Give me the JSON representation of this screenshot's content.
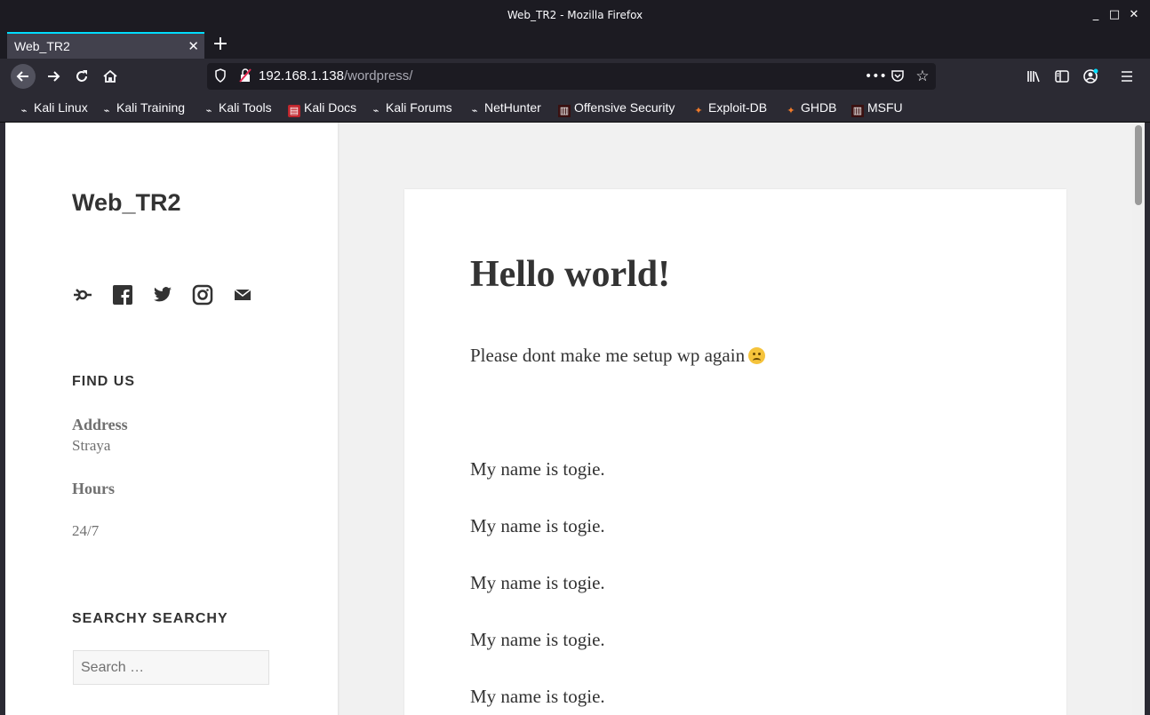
{
  "window": {
    "title": "Web_TR2 - Mozilla Firefox",
    "minimize": "_",
    "maximize": "□",
    "close": "✕"
  },
  "tab": {
    "label": "Web_TR2",
    "close": "✕"
  },
  "new_tab": "+",
  "navbar": {
    "url_host": "192.168.1.138",
    "url_path": "/wordpress/",
    "icons": [
      "back-icon",
      "forward-icon",
      "reload-icon",
      "home-icon",
      "shield-icon",
      "insecure-lock-icon",
      "more-icon",
      "pocket-icon",
      "star-icon",
      "library-icon",
      "sidebar-icon",
      "account-icon",
      "menu-icon"
    ]
  },
  "bookmarks": [
    {
      "label": "Kali Linux",
      "icon": "kali-dragon-icon"
    },
    {
      "label": "Kali Training",
      "icon": "kali-dragon-icon"
    },
    {
      "label": "Kali Tools",
      "icon": "kali-dragon-icon"
    },
    {
      "label": "Kali Docs",
      "icon": "kali-docs-icon"
    },
    {
      "label": "Kali Forums",
      "icon": "kali-dragon-icon"
    },
    {
      "label": "NetHunter",
      "icon": "kali-dragon-icon"
    },
    {
      "label": "Offensive Security",
      "icon": "offsec-icon"
    },
    {
      "label": "Exploit-DB",
      "icon": "exploitdb-icon"
    },
    {
      "label": "GHDB",
      "icon": "exploitdb-icon"
    },
    {
      "label": "MSFU",
      "icon": "offsec-icon"
    }
  ],
  "sidebar": {
    "site_title": "Web_TR2",
    "social_icons": [
      "wordpress-icon",
      "facebook-icon",
      "twitter-icon",
      "instagram-icon",
      "email-icon"
    ],
    "find_us_title": "FIND US",
    "address_label": "Address",
    "address_value": "Straya",
    "hours_label": "Hours",
    "hours_value": "24/7",
    "search_title": "SEARCHY SEARCHY",
    "search_placeholder": "Search …"
  },
  "post": {
    "title": "Hello world!",
    "intro": "Please dont make me setup wp again",
    "emoji": "frowning-face-emoji",
    "lines": [
      "My name is togie.",
      "My name is togie.",
      "My name is togie.",
      "My name is togie.",
      "My name is togie."
    ]
  },
  "colors": {
    "accent": "#00ddff",
    "chrome": "#2b2a33",
    "page_bg": "#f1f1f1"
  }
}
